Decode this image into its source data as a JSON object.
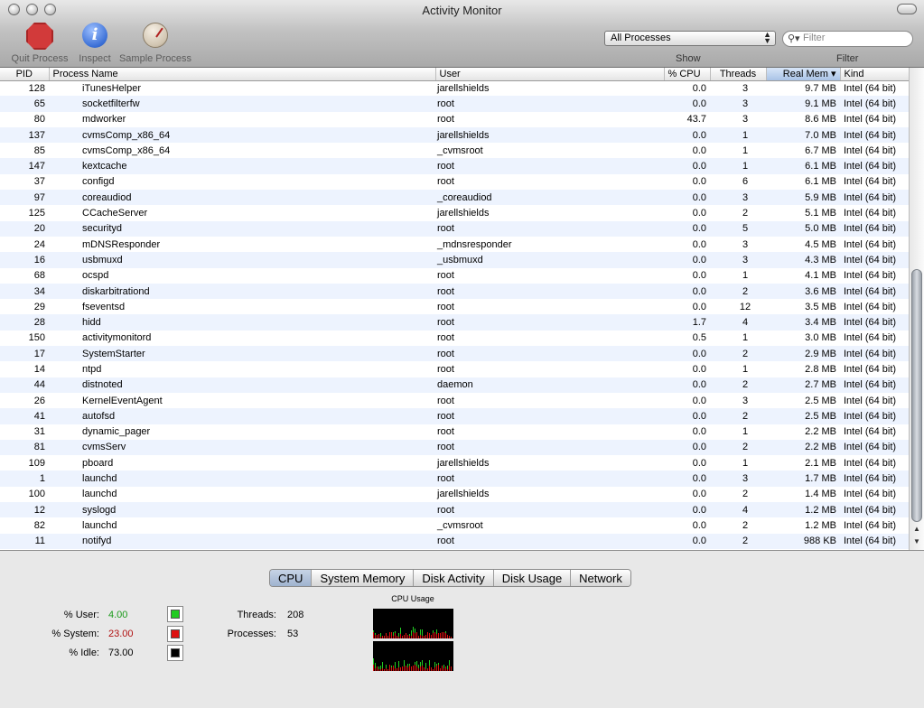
{
  "window": {
    "title": "Activity Monitor"
  },
  "toolbar": {
    "quit_label": "Quit Process",
    "inspect_label": "Inspect",
    "sample_label": "Sample Process",
    "show_select": "All Processes",
    "filter_placeholder": "Filter",
    "show_label": "Show",
    "filter_label": "Filter"
  },
  "table": {
    "columns": [
      "PID",
      "Process Name",
      "User",
      "% CPU",
      "Threads",
      "Real Mem",
      "Kind"
    ],
    "sorted_column": "Real Mem",
    "rows": [
      [
        "128",
        "iTunesHelper",
        "jarellshields",
        "0.0",
        "3",
        "9.7 MB",
        "Intel (64 bit)"
      ],
      [
        "65",
        "socketfilterfw",
        "root",
        "0.0",
        "3",
        "9.1 MB",
        "Intel (64 bit)"
      ],
      [
        "80",
        "mdworker",
        "root",
        "43.7",
        "3",
        "8.6 MB",
        "Intel (64 bit)"
      ],
      [
        "137",
        "cvmsComp_x86_64",
        "jarellshields",
        "0.0",
        "1",
        "7.0 MB",
        "Intel (64 bit)"
      ],
      [
        "85",
        "cvmsComp_x86_64",
        "_cvmsroot",
        "0.0",
        "1",
        "6.7 MB",
        "Intel (64 bit)"
      ],
      [
        "147",
        "kextcache",
        "root",
        "0.0",
        "1",
        "6.1 MB",
        "Intel (64 bit)"
      ],
      [
        "37",
        "configd",
        "root",
        "0.0",
        "6",
        "6.1 MB",
        "Intel (64 bit)"
      ],
      [
        "97",
        "coreaudiod",
        "_coreaudiod",
        "0.0",
        "3",
        "5.9 MB",
        "Intel (64 bit)"
      ],
      [
        "125",
        "CCacheServer",
        "jarellshields",
        "0.0",
        "2",
        "5.1 MB",
        "Intel (64 bit)"
      ],
      [
        "20",
        "securityd",
        "root",
        "0.0",
        "5",
        "5.0 MB",
        "Intel (64 bit)"
      ],
      [
        "24",
        "mDNSResponder",
        "_mdnsresponder",
        "0.0",
        "3",
        "4.5 MB",
        "Intel (64 bit)"
      ],
      [
        "16",
        "usbmuxd",
        "_usbmuxd",
        "0.0",
        "3",
        "4.3 MB",
        "Intel (64 bit)"
      ],
      [
        "68",
        "ocspd",
        "root",
        "0.0",
        "1",
        "4.1 MB",
        "Intel (64 bit)"
      ],
      [
        "34",
        "diskarbitrationd",
        "root",
        "0.0",
        "2",
        "3.6 MB",
        "Intel (64 bit)"
      ],
      [
        "29",
        "fseventsd",
        "root",
        "0.0",
        "12",
        "3.5 MB",
        "Intel (64 bit)"
      ],
      [
        "28",
        "hidd",
        "root",
        "1.7",
        "4",
        "3.4 MB",
        "Intel (64 bit)"
      ],
      [
        "150",
        "activitymonitord",
        "root",
        "0.5",
        "1",
        "3.0 MB",
        "Intel (64 bit)"
      ],
      [
        "17",
        "SystemStarter",
        "root",
        "0.0",
        "2",
        "2.9 MB",
        "Intel (64 bit)"
      ],
      [
        "14",
        "ntpd",
        "root",
        "0.0",
        "1",
        "2.8 MB",
        "Intel (64 bit)"
      ],
      [
        "44",
        "distnoted",
        "daemon",
        "0.0",
        "2",
        "2.7 MB",
        "Intel (64 bit)"
      ],
      [
        "26",
        "KernelEventAgent",
        "root",
        "0.0",
        "3",
        "2.5 MB",
        "Intel (64 bit)"
      ],
      [
        "41",
        "autofsd",
        "root",
        "0.0",
        "2",
        "2.5 MB",
        "Intel (64 bit)"
      ],
      [
        "31",
        "dynamic_pager",
        "root",
        "0.0",
        "1",
        "2.2 MB",
        "Intel (64 bit)"
      ],
      [
        "81",
        "cvmsServ",
        "root",
        "0.0",
        "2",
        "2.2 MB",
        "Intel (64 bit)"
      ],
      [
        "109",
        "pboard",
        "jarellshields",
        "0.0",
        "1",
        "2.1 MB",
        "Intel (64 bit)"
      ],
      [
        "1",
        "launchd",
        "root",
        "0.0",
        "3",
        "1.7 MB",
        "Intel (64 bit)"
      ],
      [
        "100",
        "launchd",
        "jarellshields",
        "0.0",
        "2",
        "1.4 MB",
        "Intel (64 bit)"
      ],
      [
        "12",
        "syslogd",
        "root",
        "0.0",
        "4",
        "1.2 MB",
        "Intel (64 bit)"
      ],
      [
        "82",
        "launchd",
        "_cvmsroot",
        "0.0",
        "2",
        "1.2 MB",
        "Intel (64 bit)"
      ],
      [
        "11",
        "notifyd",
        "root",
        "0.0",
        "2",
        "988 KB",
        "Intel (64 bit)"
      ]
    ]
  },
  "tabs": [
    "CPU",
    "System Memory",
    "Disk Activity",
    "Disk Usage",
    "Network"
  ],
  "active_tab": "CPU",
  "cpu": {
    "user_label": "% User:",
    "user_value": "4.00",
    "system_label": "% System:",
    "system_value": "23.00",
    "idle_label": "% Idle:",
    "idle_value": "73.00",
    "threads_label": "Threads:",
    "threads_value": "208",
    "processes_label": "Processes:",
    "processes_value": "53",
    "graph_title": "CPU Usage"
  },
  "colors": {
    "user": "#22cc22",
    "system": "#dd1111",
    "idle": "#000000",
    "user_text": "#1a9a1a",
    "system_text": "#b01010"
  }
}
